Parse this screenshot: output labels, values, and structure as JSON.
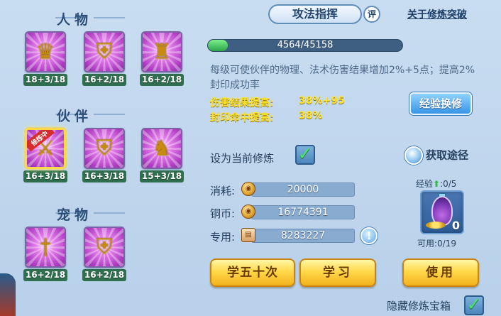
{
  "sections": {
    "renwu": {
      "title": "人物",
      "slots": [
        {
          "icon": "golden-figure-icon",
          "level": "18+3/18",
          "selected": false
        },
        {
          "icon": "golden-shield-figure-icon",
          "level": "16+2/18",
          "selected": false
        },
        {
          "icon": "golden-warrior-icon",
          "level": "16+2/18",
          "selected": false
        }
      ]
    },
    "huoban": {
      "title": "伙伴",
      "slots": [
        {
          "icon": "sword-beast-icon",
          "level": "16+3/18",
          "selected": true,
          "tag": "修炼中"
        },
        {
          "icon": "shield-beast-icon",
          "level": "16+3/18",
          "selected": false
        },
        {
          "icon": "armor-beast-icon",
          "level": "15+3/18",
          "selected": false
        }
      ]
    },
    "chongwu": {
      "title": "宠物",
      "slots": [
        {
          "icon": "sword-pet-icon",
          "level": "16+2/18",
          "selected": false
        },
        {
          "icon": "shield-pet-icon",
          "level": "16+2/18",
          "selected": false
        }
      ]
    }
  },
  "header": {
    "title": "攻法指挥",
    "badge": "评",
    "help_link": "关于修炼突破"
  },
  "progress": {
    "current": 4564,
    "max": 45158,
    "text": "4564/45158"
  },
  "description": "每级可使伙伴的物理、法术伤害结果增加2%+5点；提高2%封印成功率",
  "bonuses": [
    {
      "label": "伤害结果提高:",
      "value": "38%+95"
    },
    {
      "label": "封印命中提高:",
      "value": "38%"
    }
  ],
  "exchange_button": "经验换修",
  "set_current": {
    "label": "设为当前修炼",
    "checked": true
  },
  "obtain_link": "获取途径",
  "resources": [
    {
      "label": "消耗:",
      "icon": "copper-coin-icon",
      "value": "20000"
    },
    {
      "label": "铜币:",
      "icon": "copper-coin-icon",
      "value": "16774391"
    },
    {
      "label": "专用:",
      "icon": "voucher-icon",
      "value": "8283227"
    }
  ],
  "experience": {
    "label": "经验",
    "value": ":0/5"
  },
  "item": {
    "icon": "potion-icon",
    "count": "0",
    "available": "可用:0/19"
  },
  "buttons": {
    "learn50": "学五十次",
    "learn": "学习",
    "use": "使用"
  },
  "hide_box": {
    "label": "隐藏修炼宝箱",
    "checked": true
  },
  "colors": {
    "background": "#c9ddf1",
    "slot_purple": "#b13fc4",
    "level_green": "#2f6f4e",
    "bonus_yellow": "#ffe22c",
    "gold_button": "#ffd84a",
    "blue_button": "#3895e6",
    "progress_green": "#2ca44a"
  }
}
